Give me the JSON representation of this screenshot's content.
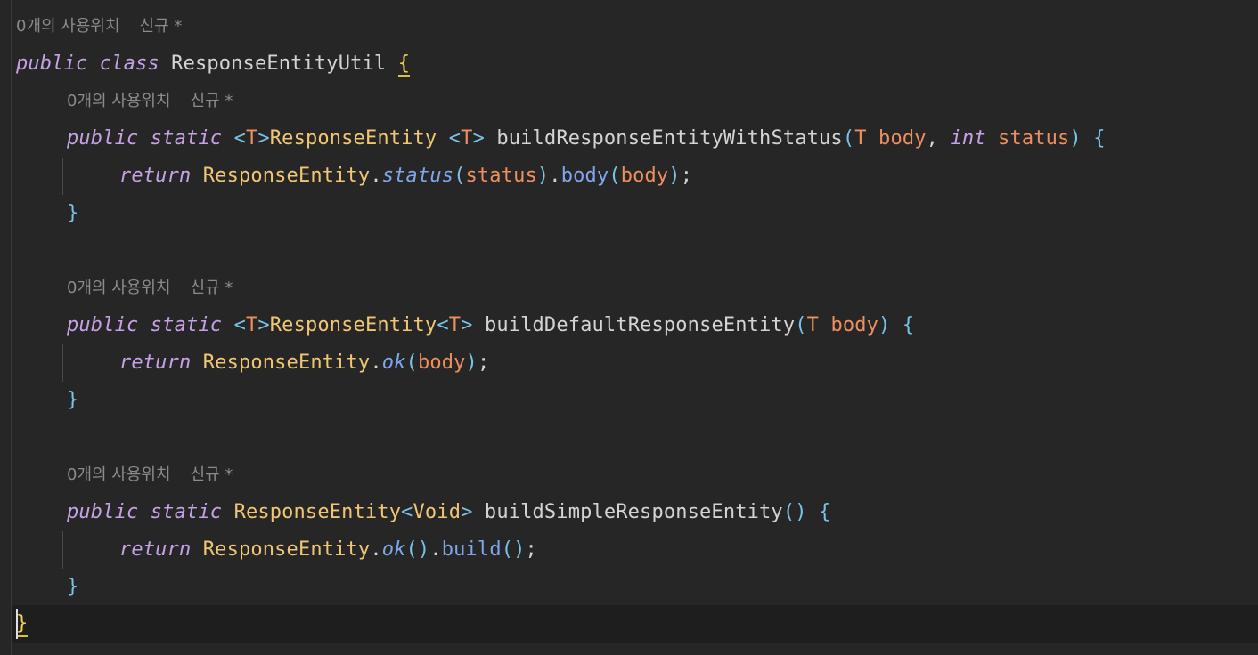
{
  "editor": {
    "language": "java",
    "codelens": {
      "usages": "0개의 사용위치",
      "status": "신규 *"
    },
    "lines": {
      "class_kw_public": "public",
      "class_kw_class": "class",
      "class_name": "ResponseEntityUtil",
      "open_brace": "{",
      "close_brace": "}",
      "m1_public": "public",
      "m1_static": "static",
      "m1_lt1": "<",
      "m1_t1": "T",
      "m1_gt1": ">",
      "m1_rtype": "ResponseEntity",
      "m1_sp": " ",
      "m1_lt2": "<",
      "m1_t2": "T",
      "m1_gt2": ">",
      "m1_name": "buildResponseEntityWithStatus",
      "m1_lp": "(",
      "m1_ptype1": "T",
      "m1_pname1": "body",
      "m1_comma": ",",
      "m1_ptype2": "int",
      "m1_pname2": "status",
      "m1_rp": ")",
      "m1_ob": "{",
      "m1_return": "return",
      "m1_cls": "ResponseEntity",
      "m1_dot1": ".",
      "m1_call1": "status",
      "m1_lp1": "(",
      "m1_arg1": "status",
      "m1_rp1": ")",
      "m1_dot2": ".",
      "m1_call2": "body",
      "m1_lp2": "(",
      "m1_arg2": "body",
      "m1_rp2": ")",
      "m1_semi": ";",
      "m1_cb": "}",
      "m2_public": "public",
      "m2_static": "static",
      "m2_lt1": "<",
      "m2_t1": "T",
      "m2_gt1": ">",
      "m2_rtype": "ResponseEntity",
      "m2_lt2": "<",
      "m2_t2": "T",
      "m2_gt2": ">",
      "m2_name": "buildDefaultResponseEntity",
      "m2_lp": "(",
      "m2_ptype": "T",
      "m2_pname": "body",
      "m2_rp": ")",
      "m2_ob": "{",
      "m2_return": "return",
      "m2_cls": "ResponseEntity",
      "m2_dot": ".",
      "m2_call": "ok",
      "m2_lp1": "(",
      "m2_arg": "body",
      "m2_rp1": ")",
      "m2_semi": ";",
      "m2_cb": "}",
      "m3_public": "public",
      "m3_static": "static",
      "m3_rtype": "ResponseEntity",
      "m3_lt": "<",
      "m3_gen": "Void",
      "m3_gt": ">",
      "m3_name": "buildSimpleResponseEntity",
      "m3_parens": "()",
      "m3_ob": "{",
      "m3_return": "return",
      "m3_cls": "ResponseEntity",
      "m3_dot1": ".",
      "m3_call1": "ok",
      "m3_parens1": "()",
      "m3_dot2": ".",
      "m3_call2": "build",
      "m3_parens2": "()",
      "m3_semi": ";",
      "m3_cb": "}"
    }
  },
  "colors": {
    "background": "#262626",
    "current_line": "#1e1e1e",
    "keyword": "#c7a1e6",
    "class_type": "#f0c674",
    "type_param": "#ed8f5f",
    "function": "#7fa6ec",
    "bracket": "#79c3e8",
    "codelens": "#8b8b8b",
    "brace_match_underline": "#e0c034"
  }
}
